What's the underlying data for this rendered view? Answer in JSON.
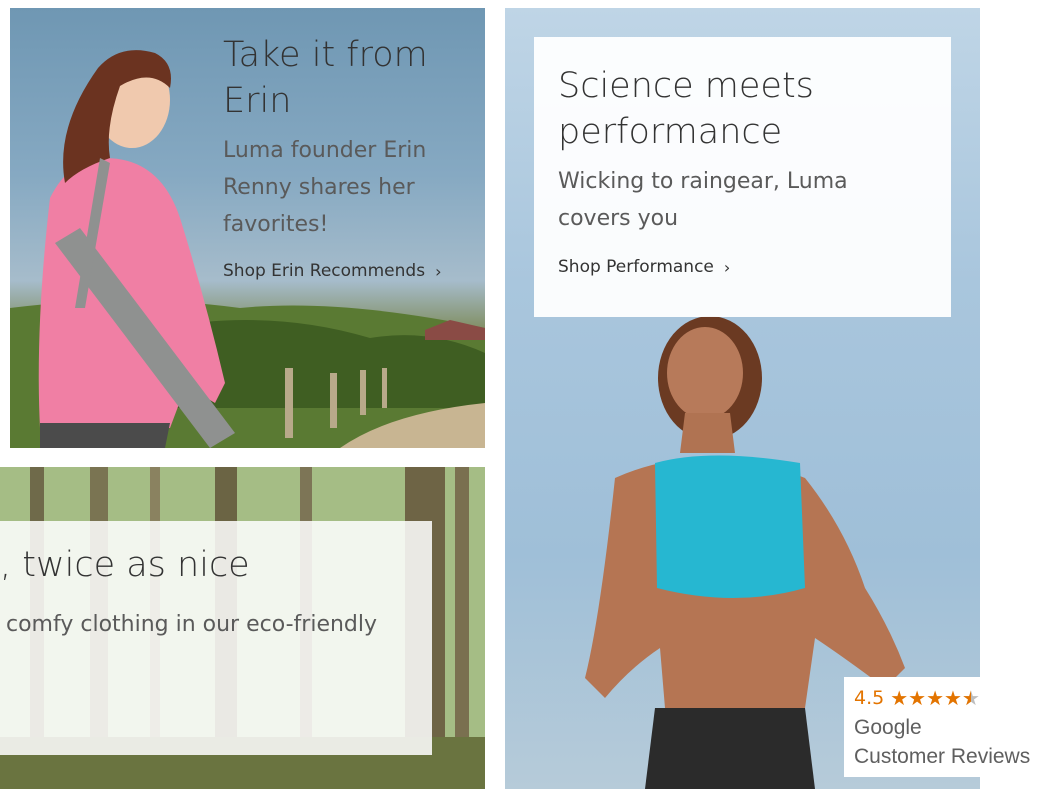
{
  "erin_block": {
    "title": "Take it from Erin",
    "text": "Luma founder Erin Renny shares her favorites!",
    "link_label": "Shop Erin Recommends",
    "link_icon": "chevron-right-icon"
  },
  "eco_block": {
    "title": ", twice as nice",
    "text": "comfy clothing in our eco-friendly"
  },
  "performance_block": {
    "title": "Science meets performance",
    "text": "Wicking to raingear, Luma covers you",
    "link_label": "Shop Performance",
    "link_icon": "chevron-right-icon"
  },
  "google_badge": {
    "rating": "4.5",
    "rating_value": 4.5,
    "stars_max": 5,
    "name": "Google",
    "subtitle": "Customer Reviews",
    "star_color": "#e37400"
  }
}
